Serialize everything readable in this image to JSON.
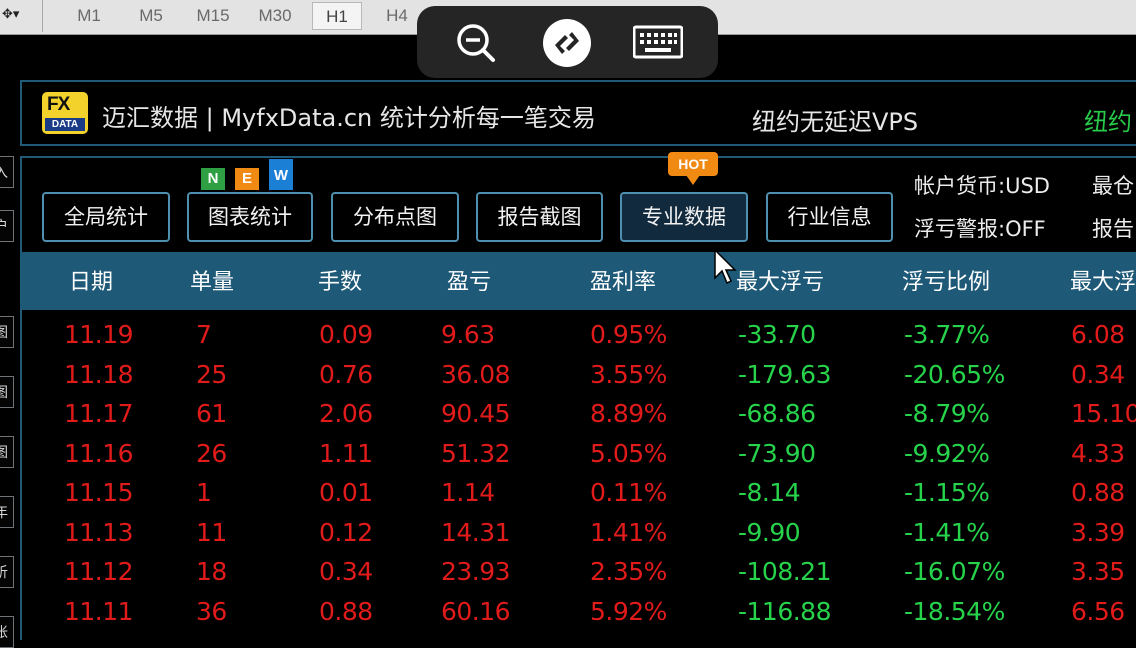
{
  "toolbar": {
    "timeframes": [
      "M1",
      "M5",
      "M15",
      "M30",
      "H1",
      "H4"
    ],
    "active_timeframe": "H1"
  },
  "remote_overlay": {
    "buttons": [
      "zoom-out-icon",
      "remote-connection-icon",
      "keyboard-icon"
    ]
  },
  "left_strip": {
    "tabs": [
      "入",
      "户",
      "图",
      "图",
      "图",
      "年",
      "析",
      "帐"
    ]
  },
  "brand": {
    "logo_top": "FX",
    "logo_bottom": "DATA",
    "title": "迈汇数据 | MyfxData.cn  统计分析每一笔交易",
    "promo1": "纽约无延迟VPS",
    "promo2": "纽约"
  },
  "buttons": [
    {
      "label": "全局统计"
    },
    {
      "label": "图表统计"
    },
    {
      "label": "分布点图"
    },
    {
      "label": "报告截图"
    },
    {
      "label": "专业数据"
    },
    {
      "label": "行业信息"
    }
  ],
  "badges": {
    "new": [
      "N",
      "E",
      "W"
    ],
    "hot": "HOT"
  },
  "account": {
    "currency": "帐户货币:USD",
    "alarm": "浮亏警报:OFF",
    "extra1": "最仓",
    "extra2": "报告"
  },
  "table": {
    "headers": [
      "日期",
      "单量",
      "手数",
      "盈亏",
      "盈利率",
      "最大浮亏",
      "浮亏比例",
      "最大浮"
    ],
    "rows": [
      [
        "11.19",
        "7",
        "0.09",
        "9.63",
        "0.95%",
        "-33.70",
        "-3.77%",
        "6.08"
      ],
      [
        "11.18",
        "25",
        "0.76",
        "36.08",
        "3.55%",
        "-179.63",
        "-20.65%",
        "0.34"
      ],
      [
        "11.17",
        "61",
        "2.06",
        "90.45",
        "8.89%",
        "-68.86",
        "-8.79%",
        "15.10"
      ],
      [
        "11.16",
        "26",
        "1.11",
        "51.32",
        "5.05%",
        "-73.90",
        "-9.92%",
        "4.33"
      ],
      [
        "11.15",
        "1",
        "0.01",
        "1.14",
        "0.11%",
        "-8.14",
        "-1.15%",
        "0.88"
      ],
      [
        "11.13",
        "11",
        "0.12",
        "14.31",
        "1.41%",
        "-9.90",
        "-1.41%",
        "3.39"
      ],
      [
        "11.12",
        "18",
        "0.34",
        "23.93",
        "2.35%",
        "-108.21",
        "-16.07%",
        "3.35"
      ],
      [
        "11.11",
        "36",
        "0.88",
        "60.16",
        "5.92%",
        "-116.88",
        "-18.54%",
        "6.56"
      ]
    ]
  },
  "colors": {
    "profit": "#e11a1a",
    "drawdown": "#26d34b",
    "header_bg": "#1e5978",
    "hot": "#f08a12",
    "logo": "#f2d22b"
  }
}
